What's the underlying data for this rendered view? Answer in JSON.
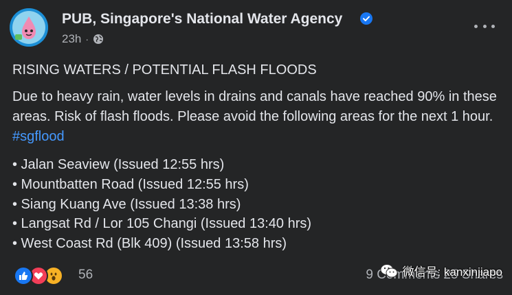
{
  "post": {
    "author": "PUB, Singapore's National Water Agency",
    "time": "23h",
    "headline": "RISING WATERS / POTENTIAL FLASH FLOODS",
    "body_text": "Due to heavy rain, water levels in drains and canals have reached 90% in these areas. Risk of flash floods. Please avoid the following areas for the next 1 hour.",
    "hashtag": "#sgflood",
    "areas": [
      "• Jalan Seaview (Issued 12:55 hrs)",
      "• Mountbatten Road (Issued 12:55 hrs)",
      "• Siang Kuang Ave (Issued 13:38 hrs)",
      "• Langsat Rd / Lor 105 Changi (Issued 13:40 hrs)",
      "• West Coast Rd (Blk 409) (Issued 13:58 hrs)"
    ]
  },
  "footer": {
    "reaction_count": "56",
    "stats": "9 Comments 25 Shares",
    "reaction_icons": [
      "like-icon",
      "love-icon",
      "wow-icon"
    ]
  },
  "watermark": {
    "text": "微信号: kanxinjiapo"
  },
  "colors": {
    "background": "#242526",
    "text": "#e4e6eb",
    "muted": "#b0b3b8",
    "hashtag": "#4599ff",
    "verified": "#1877f2"
  }
}
